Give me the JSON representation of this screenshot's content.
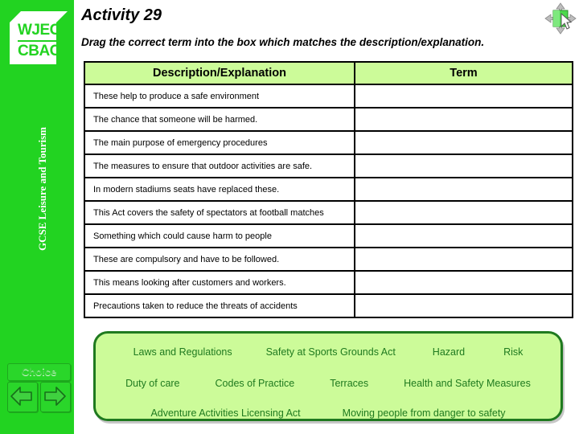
{
  "sidebar": {
    "logo": {
      "line1": "WJEC",
      "line2": "CBAC"
    },
    "course_label": "GCSE Leisure and Tourism",
    "choice_button": "Choice",
    "prev_icon": "left-arrow-icon",
    "next_icon": "right-arrow-icon"
  },
  "header": {
    "title": "Activity 29",
    "instruction": "Drag the correct term into the box which matches the description/explanation.",
    "drag_icon": "drag-move-icon"
  },
  "table": {
    "columns": [
      "Description/Explanation",
      "Term"
    ],
    "rows": [
      {
        "description": "These help to produce a safe environment",
        "term": ""
      },
      {
        "description": "The chance that someone will be harmed.",
        "term": ""
      },
      {
        "description": "The main purpose of emergency procedures",
        "term": ""
      },
      {
        "description": "The measures to ensure that outdoor activities are safe.",
        "term": ""
      },
      {
        "description": "In modern stadiums seats have replaced these.",
        "term": ""
      },
      {
        "description": "This Act covers the safety of spectators at football matches",
        "term": ""
      },
      {
        "description": "Something which could cause harm to people",
        "term": ""
      },
      {
        "description": "These are compulsory and have to be followed.",
        "term": ""
      },
      {
        "description": "This means looking after customers and workers.",
        "term": ""
      },
      {
        "description": "Precautions taken to reduce the threats of accidents",
        "term": ""
      }
    ]
  },
  "choice_pool": {
    "rows": [
      [
        "Laws and Regulations",
        "Safety at Sports Grounds Act",
        "Hazard",
        "Risk"
      ],
      [
        "Duty of care",
        "Codes of Practice",
        "Terraces",
        "Health and Safety Measures"
      ],
      [
        "Adventure Activities Licensing Act",
        "Moving people from danger to safety"
      ]
    ]
  },
  "colors": {
    "sidebar_green": "#22d321",
    "header_green": "#ccfb99",
    "pool_border": "#1f7a1f",
    "pool_text": "#1f7a1f"
  }
}
